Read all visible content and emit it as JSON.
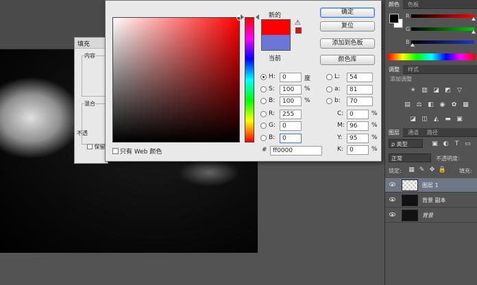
{
  "fill_dialog": {
    "title": "填充",
    "content_label": "内容",
    "blend_label": "混合",
    "opacity_label": "不透",
    "preserve_label": "保留"
  },
  "picker": {
    "new_label": "新的",
    "current_label": "当前",
    "new_color": "#ff0000",
    "current_color": "#6b77d6",
    "buttons": {
      "ok": "确定",
      "reset": "复位",
      "add_swatch": "添加到色板",
      "library": "颜色库"
    },
    "hsb": [
      {
        "label": "H:",
        "value": "0",
        "unit": "度",
        "selected": true
      },
      {
        "label": "S:",
        "value": "100",
        "unit": "%",
        "selected": false
      },
      {
        "label": "B:",
        "value": "100",
        "unit": "%",
        "selected": false
      }
    ],
    "rgb": [
      {
        "label": "R:",
        "value": "255"
      },
      {
        "label": "G:",
        "value": "0"
      },
      {
        "label": "B:",
        "value": "0"
      }
    ],
    "lab": [
      {
        "label": "L:",
        "value": "54"
      },
      {
        "label": "a:",
        "value": "81"
      },
      {
        "label": "b:",
        "value": "70"
      }
    ],
    "cmyk": [
      {
        "label": "C:",
        "value": "0",
        "unit": "%"
      },
      {
        "label": "M:",
        "value": "96",
        "unit": "%"
      },
      {
        "label": "Y:",
        "value": "95",
        "unit": "%"
      },
      {
        "label": "K:",
        "value": "0",
        "unit": "%"
      }
    ],
    "web_only_label": "只有 Web 颜色",
    "hex_label": "#",
    "hex_value": "ff0000"
  },
  "panels": {
    "color_tabs": [
      "颜色",
      "色板"
    ],
    "sliders": [
      {
        "label": "R",
        "color": "#d02020",
        "position": 0.9
      },
      {
        "label": "G",
        "color": "#20a020",
        "position": 0.9
      },
      {
        "label": "B",
        "color": "#2040d0",
        "position": 0.05
      }
    ],
    "adjust_tabs": [
      "调整",
      "样式"
    ],
    "adjust_title": "添加调整",
    "layer_tabs": [
      "图层",
      "通道",
      "路径"
    ],
    "kind_filter": "ρ 类型",
    "blend_mode": "正常",
    "opacity_label": "不透明度:",
    "lock_label": "锁定:",
    "fill_label": "填充:",
    "layers": [
      {
        "name": "图层 1",
        "selected": true,
        "italic": false
      },
      {
        "name": "背景 副本",
        "selected": false,
        "italic": false
      },
      {
        "name": "背景",
        "selected": false,
        "italic": true
      }
    ]
  }
}
